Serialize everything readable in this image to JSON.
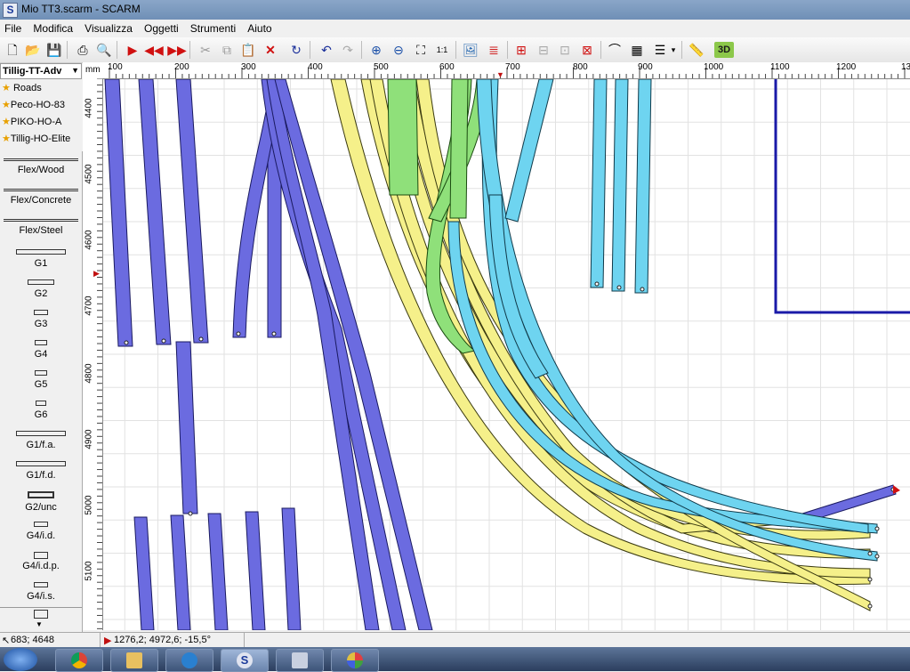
{
  "window": {
    "title": "Mio TT3.scarm - SCARM",
    "app_icon_letter": "S"
  },
  "menu": [
    "File",
    "Modifica",
    "Visualizza",
    "Oggetti",
    "Strumenti",
    "Aiuto"
  ],
  "library": {
    "selected": "Tillig-TT-Adv",
    "favorites": [
      "Roads",
      "Peco-HO-83",
      "PIKO-HO-A",
      "Tillig-HO-Elite"
    ],
    "parts": [
      "Flex/Wood",
      "Flex/Concrete",
      "Flex/Steel",
      "G1",
      "G2",
      "G3",
      "G4",
      "G5",
      "G6",
      "G1/f.a.",
      "G1/f.d.",
      "G2/unc",
      "G4/i.d.",
      "G4/i.d.p.",
      "G4/i.s."
    ]
  },
  "ruler": {
    "unit": "mm",
    "h_labels": [
      "100",
      "200",
      "300",
      "400",
      "500",
      "600",
      "700",
      "800",
      "900",
      "1000",
      "1100",
      "1200",
      "13"
    ],
    "v_labels": [
      "4400",
      "4500",
      "4600",
      "4700",
      "4800",
      "4900",
      "5000",
      "5100"
    ]
  },
  "status": {
    "cursor": "683; 4648",
    "selection": "1276,2; 4972,6; -15,5°"
  },
  "colors": {
    "blue_track": "#6b6be0",
    "yellow_track": "#f5f08a",
    "green_track": "#8fe07a",
    "cyan_track": "#6ed4f0",
    "board_line": "#1a1aa8"
  }
}
